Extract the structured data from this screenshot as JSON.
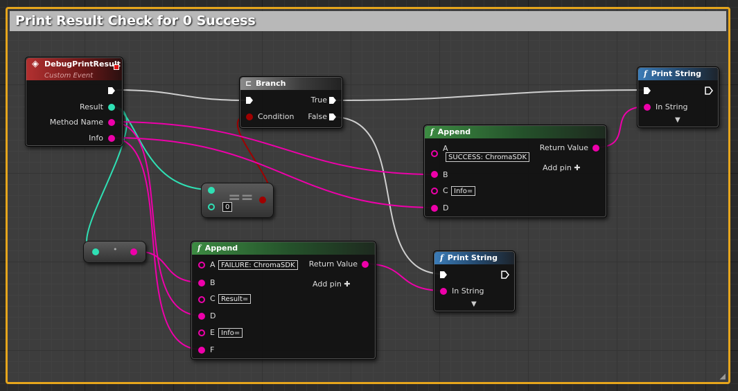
{
  "comment": {
    "title": "Print Result Check for 0 Success"
  },
  "event_node": {
    "title": "DebugPrintResult",
    "subtitle": "Custom Event",
    "outputs": [
      "Result",
      "Method Name",
      "Info"
    ]
  },
  "branch_node": {
    "title": "Branch",
    "input_label": "Condition",
    "true_label": "True",
    "false_label": "False"
  },
  "equals_node": {
    "symbol": "==",
    "input_value": "0"
  },
  "append_success": {
    "title": "Append",
    "pins": [
      "A",
      "B",
      "C",
      "D"
    ],
    "a_value": "SUCCESS: ChromaSDK",
    "c_value": "Info=",
    "return_label": "Return Value",
    "add_pin": "Add pin"
  },
  "append_failure": {
    "title": "Append",
    "pins": [
      "A",
      "B",
      "C",
      "D",
      "E",
      "F"
    ],
    "a_value": "FAILURE: ChromaSDK",
    "c_value": "Result=",
    "e_value": "Info=",
    "return_label": "Return Value",
    "add_pin": "Add pin"
  },
  "print_top": {
    "title": "Print String",
    "input_label": "In String"
  },
  "print_bottom": {
    "title": "Print String",
    "input_label": "In String"
  },
  "colors": {
    "comment_border": "#e6a51c",
    "string_pin": "#ee00aa",
    "int_pin": "#2fe0b4",
    "bool_pin": "#a00000",
    "exec_pin": "#ffffff"
  }
}
